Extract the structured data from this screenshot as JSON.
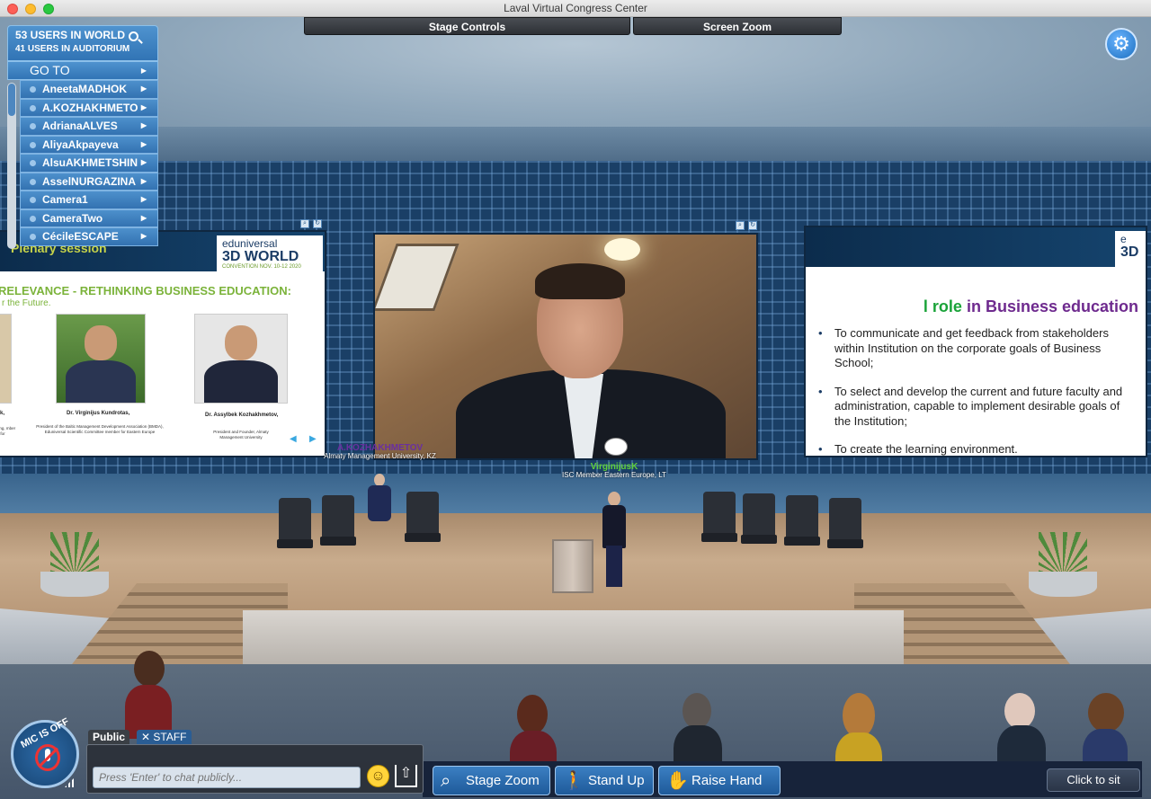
{
  "window": {
    "title": "Laval Virtual Congress Center"
  },
  "top_controls": {
    "stage_controls": "Stage Controls",
    "screen_zoom": "Screen Zoom"
  },
  "user_panel": {
    "users_in_world": "53 USERS IN WORLD",
    "users_in_auditorium": "41 USERS IN AUDITORIUM",
    "goto_label": "GO TO",
    "users": [
      "AneetaMADHOK",
      "A.KOZHAKHMETOV",
      "AdrianaALVES",
      "AliyaAkpayeva",
      "AlsuAKHMETSHIN",
      "AsselNURGAZINA",
      "Camera1",
      "CameraTwo",
      "CécileESCAPE"
    ]
  },
  "left_slide": {
    "session": "Plenary session",
    "logo_line1": "eduniversal",
    "logo_line2": "3D WORLD",
    "logo_line3": "CONVENTION NOV. 10-12 2020",
    "title": "RELEVANCE - RETHINKING BUSINESS EDUCATION:",
    "subtitle": "r the Future.",
    "speakers": [
      {
        "name": "k,",
        "desc": "nsulting, mber for"
      },
      {
        "name": "Dr. Virginijus Kundrotas,",
        "desc": "President of the Baltic Management Development Association (BMDA), Eduniversal Scientific Committee member for Eastern Europe"
      },
      {
        "name": "Dr. Assylbek Kozhakhmetov,",
        "desc": "President and Founder, Almaty Management University"
      }
    ]
  },
  "right_slide": {
    "logo_line1": "e",
    "logo_line2": "3D",
    "title_green": "l role",
    "title_purple": "in Business education",
    "bullets": [
      "To communicate and get feedback from stakeholders within Institution on the corporate goals of Business School;",
      "To select and develop the current and future faculty and administration, capable to implement desirable goals of the Institution;",
      "To create the learning environment."
    ]
  },
  "nametags": {
    "kozhakhmetov": {
      "name": "A.KOZHAKHMETOV",
      "affiliation": "Almaty Management University, KZ",
      "color": "#6a2fa0"
    },
    "virginijusk": {
      "name": "VirginijusK",
      "affiliation": "ISC Member Eastern Europe, LT",
      "color": "#5fcf3a"
    }
  },
  "chat": {
    "tab_public": "Public",
    "tab_staff": "STAFF",
    "staff_close": "✕",
    "placeholder": "Press 'Enter' to chat publicly..."
  },
  "mic": {
    "status": "MIC IS OFF"
  },
  "actions": {
    "stage_zoom": "Stage Zoom",
    "stand_up": "Stand Up",
    "raise_hand": "Raise Hand",
    "click_to_sit": "Click to sit"
  },
  "icons": {
    "search": "search-icon",
    "gear": "gear-icon",
    "chevron": "chevron-right-icon",
    "mic": "mic-off-icon",
    "emoji": "smiley-icon",
    "upload": "upload-icon",
    "zoom": "magnifier-icon",
    "stand": "person-icon",
    "hand": "hand-icon"
  }
}
